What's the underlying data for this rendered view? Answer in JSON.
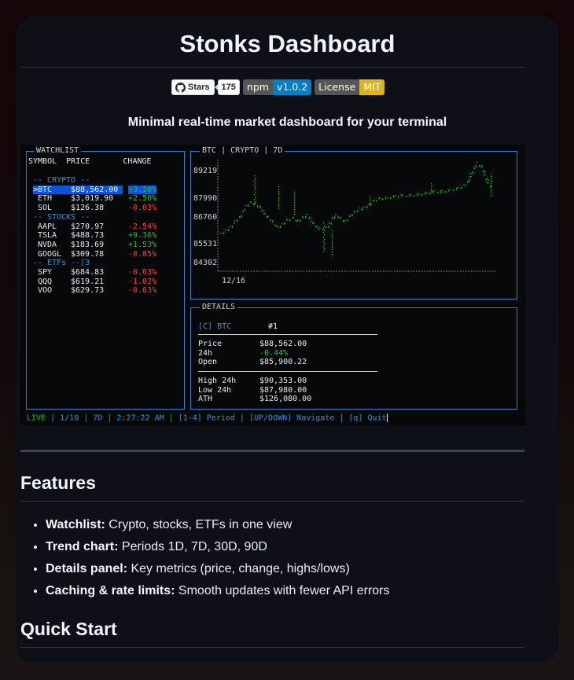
{
  "page": {
    "title": "Stonks Dashboard",
    "subtitle": "Minimal real-time market dashboard for your terminal"
  },
  "badges": {
    "github": {
      "label": "Stars",
      "count": "175",
      "icon": "github-icon"
    },
    "npm": {
      "label": "npm",
      "value": "v1.0.2"
    },
    "license": {
      "label": "License",
      "value": "MIT"
    }
  },
  "terminal": {
    "watchlist": {
      "title": "WATCHLIST",
      "header": "SYMBOL  PRICE       CHANGE",
      "sections": [
        {
          "label": "-- CRYPTO --",
          "rows": [
            {
              "symbol": ">BTC",
              "price": "$88,562.00",
              "change": "+3.10%",
              "dir": "up",
              "selected": true
            },
            {
              "symbol": "ETH",
              "price": "$3,019.90",
              "change": "+2.50%",
              "dir": "up"
            },
            {
              "symbol": "SOL",
              "price": "$126.38",
              "change": "-0.03%",
              "dir": "down"
            }
          ]
        },
        {
          "label": "-- STOCKS --",
          "rows": [
            {
              "symbol": "AAPL",
              "price": "$270.97",
              "change": "-2.54%",
              "dir": "down"
            },
            {
              "symbol": "TSLA",
              "price": "$488.73",
              "change": "+9.36%",
              "dir": "up"
            },
            {
              "symbol": "NVDA",
              "price": "$183.69",
              "change": "+1.53%",
              "dir": "up"
            },
            {
              "symbol": "GOOGL",
              "price": "$309.78",
              "change": "-0.85%",
              "dir": "down"
            }
          ]
        },
        {
          "label": "-- ETFs --[3",
          "rows": [
            {
              "symbol": "SPY",
              "price": "$684.83",
              "change": "-0.63%",
              "dir": "down"
            },
            {
              "symbol": "QQQ",
              "price": "$619.21",
              "change": "-1.02%",
              "dir": "down"
            },
            {
              "symbol": "VOO",
              "price": "$629.73",
              "change": "-0.63%",
              "dir": "down"
            }
          ]
        }
      ]
    },
    "chart": {
      "title": "BTC | CRYPTO | 7D",
      "y_labels": [
        "89219",
        "87990",
        "86760",
        "85531",
        "84302"
      ],
      "x_label": "12/16",
      "color": "#26c226"
    },
    "details": {
      "title": "DETAILS",
      "heading_tag": "[C] BTC",
      "heading_rank": "#1",
      "rows_a": [
        {
          "label": "Price",
          "value": "$88,562.00"
        },
        {
          "label": "24h",
          "value": "-0.44%",
          "tone": "green"
        },
        {
          "label": "Open",
          "value": "$85,900.22"
        }
      ],
      "rows_b": [
        {
          "label": "High 24h",
          "value": "$90,353.00"
        },
        {
          "label": "Low 24h",
          "value": "$87,980.00"
        },
        {
          "label": "ATH",
          "value": "$126,080.00"
        }
      ]
    },
    "status": {
      "live": "LIVE",
      "rest": " | 1/10 | 7D | 2:27:22 AM | [1-4] Period | [UP/DOWN] Navigate | [q] Quit"
    }
  },
  "features": {
    "heading": "Features",
    "items": [
      {
        "bold": "Watchlist:",
        "text": " Crypto, stocks, ETFs in one view"
      },
      {
        "bold": "Trend chart:",
        "text": " Periods 1D, 7D, 30D, 90D"
      },
      {
        "bold": "Details panel:",
        "text": " Key metrics (price, change, highs/lows)"
      },
      {
        "bold": "Caching & rate limits:",
        "text": " Smooth updates with fewer API errors"
      }
    ]
  },
  "quickstart": {
    "heading": "Quick Start"
  }
}
